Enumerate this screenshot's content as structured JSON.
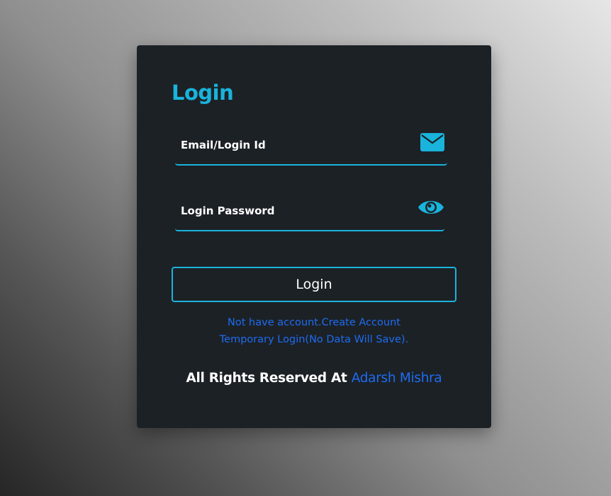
{
  "login_card": {
    "title": "Login",
    "email_field": {
      "label": "Email/Login Id",
      "icon": "envelope-icon"
    },
    "password_field": {
      "label": "Login Password",
      "icon": "eye-icon"
    },
    "login_button_label": "Login",
    "create_account_link": "Not have account.Create Account",
    "temporary_login_link": "Temporary Login(No Data Will Save).",
    "footer": {
      "prefix": "All Rights Reserved At ",
      "author": "Adarsh Mishra"
    }
  },
  "colors": {
    "accent": "#19b3dc",
    "link": "#1e6cf0",
    "card_background": "#1c2126"
  }
}
